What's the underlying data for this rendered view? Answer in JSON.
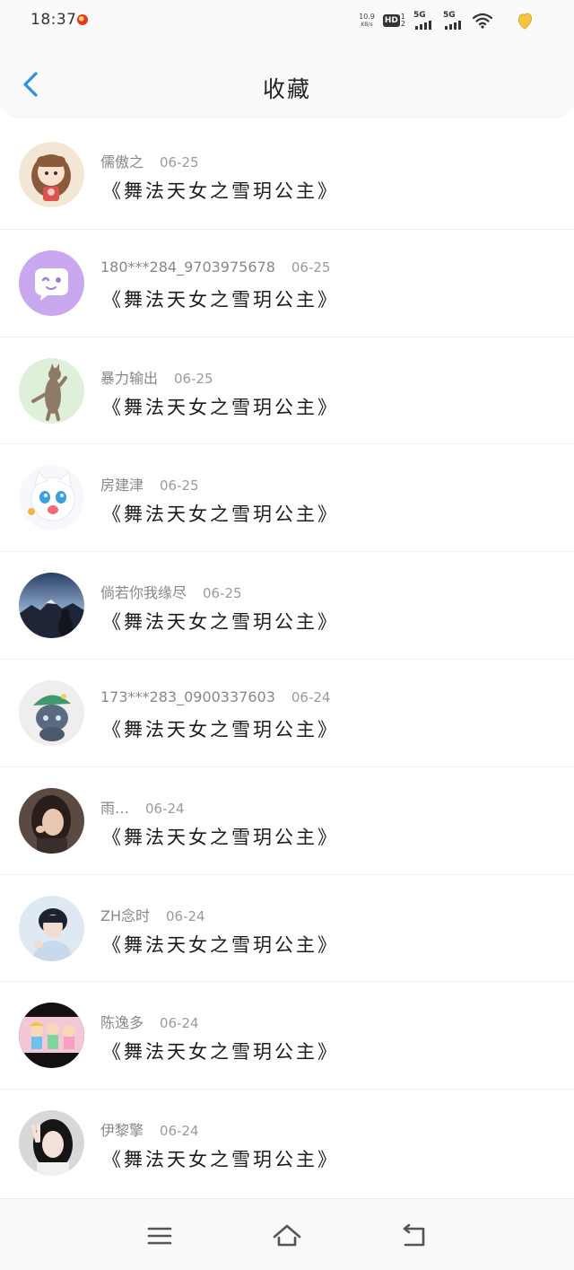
{
  "status_bar": {
    "time": "18:37",
    "net_speed_value": "10.9",
    "net_speed_unit": "KB/s",
    "hd_label": "HD",
    "hd_sub_top": "1",
    "hd_sub_bottom": "2",
    "signal1_label": "5G",
    "signal2_label": "5G"
  },
  "header": {
    "title": "收藏"
  },
  "favorites": [
    {
      "user": "儒傲之",
      "date": "06-25",
      "content": "《舞法天女之雪玥公主》",
      "avatar": "cartoon-girl-avatar"
    },
    {
      "user": "180***284_9703975678",
      "date": "06-25",
      "content": "《舞法天女之雪玥公主》",
      "avatar": "purple-chat-avatar"
    },
    {
      "user": "暴力输出",
      "date": "06-25",
      "content": "《舞法天女之雪玥公主》",
      "avatar": "cat-standing-avatar"
    },
    {
      "user": "房建津",
      "date": "06-25",
      "content": "《舞法天女之雪玥公主》",
      "avatar": "cartoon-cat-avatar"
    },
    {
      "user": "倘若你我缘尽",
      "date": "06-25",
      "content": "《舞法天女之雪玥公主》",
      "avatar": "mountain-sunset-avatar"
    },
    {
      "user": "173***283_0900337603",
      "date": "06-24",
      "content": "《舞法天女之雪玥公主》",
      "avatar": "gray-cat-green-hat-avatar"
    },
    {
      "user": "雨…",
      "date": "06-24",
      "content": "《舞法天女之雪玥公主》",
      "avatar": "girl-photo-avatar"
    },
    {
      "user": "ZH念时",
      "date": "06-24",
      "content": "《舞法天女之雪玥公主》",
      "avatar": "boy-photo-avatar"
    },
    {
      "user": "陈逸多",
      "date": "06-24",
      "content": "《舞法天女之雪玥公主》",
      "avatar": "anime-characters-avatar"
    },
    {
      "user": "伊黎擎",
      "date": "06-24",
      "content": "《舞法天女之雪玥公主》",
      "avatar": "girl-peace-sign-avatar"
    }
  ],
  "nav": {
    "menu_icon": "menu-icon",
    "home_icon": "home-icon",
    "back_icon": "return-icon"
  },
  "colors": {
    "accent": "#2f8fe6",
    "background": "#ffffff",
    "bar_background": "#fafafa"
  }
}
